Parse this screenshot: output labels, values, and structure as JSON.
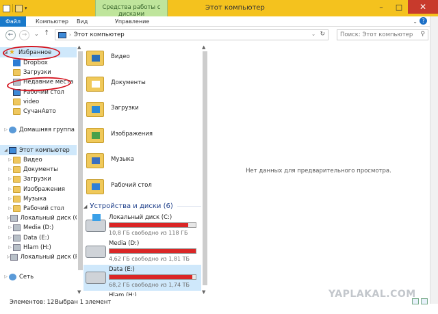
{
  "window": {
    "title": "Этот компьютер"
  },
  "ribbon": {
    "context_tab": "Средства работы с дисками",
    "tabs": [
      "Файл",
      "Компьютер",
      "Вид",
      "Управление"
    ]
  },
  "address": {
    "path": "Этот компьютер",
    "search_placeholder": "Поиск: Этот компьютер"
  },
  "nav": {
    "items": [
      {
        "label": "Избранное",
        "icon": "star-icon",
        "kind": "header",
        "selected": true
      },
      {
        "label": "Dropbox",
        "icon": "dropbox-icon"
      },
      {
        "label": "Загрузки",
        "icon": "folder-icon"
      },
      {
        "label": "Недавние места",
        "icon": "recent-places-icon"
      },
      {
        "label": "Рабочий стол",
        "icon": "desktop-icon"
      },
      {
        "label": "video",
        "icon": "folder-icon"
      },
      {
        "label": "СучанАвто",
        "icon": "folder-icon"
      },
      {
        "label": "Домашняя группа",
        "icon": "homegroup-icon",
        "kind": "header"
      },
      {
        "label": "Этот компьютер",
        "icon": "computer-icon",
        "kind": "header",
        "selected": true
      },
      {
        "label": "Видео",
        "icon": "folder-icon"
      },
      {
        "label": "Документы",
        "icon": "folder-icon"
      },
      {
        "label": "Загрузки",
        "icon": "folder-icon"
      },
      {
        "label": "Изображения",
        "icon": "folder-icon"
      },
      {
        "label": "Музыка",
        "icon": "folder-icon"
      },
      {
        "label": "Рабочий стол",
        "icon": "folder-icon"
      },
      {
        "label": "Локальный диск (C",
        "icon": "drive-icon"
      },
      {
        "label": "Media (D:)",
        "icon": "drive-icon"
      },
      {
        "label": "Data (E:)",
        "icon": "drive-icon"
      },
      {
        "label": "Hlam (H:)",
        "icon": "drive-icon"
      },
      {
        "label": "Локальный диск (R",
        "icon": "drive-icon"
      },
      {
        "label": "Сеть",
        "icon": "network-icon",
        "kind": "header"
      }
    ]
  },
  "folders": [
    {
      "label": "Видео",
      "icon": "video-folder-icon"
    },
    {
      "label": "Документы",
      "icon": "documents-folder-icon"
    },
    {
      "label": "Загрузки",
      "icon": "downloads-folder-icon"
    },
    {
      "label": "Изображения",
      "icon": "pictures-folder-icon"
    },
    {
      "label": "Музыка",
      "icon": "music-folder-icon"
    },
    {
      "label": "Рабочий стол",
      "icon": "desktop-folder-icon"
    }
  ],
  "devices": {
    "heading": "Устройства и диски (6)",
    "items": [
      {
        "label": "Локальный диск (C:)",
        "free": "10,8 ГБ свободно из 118 ГБ",
        "used_fraction": 0.91
      },
      {
        "label": "Media (D:)",
        "free": "4,62 ГБ свободно из 1,81 ТБ",
        "used_fraction": 0.997
      },
      {
        "label": "Data (E:)",
        "free": "68,2 ГБ свободно из 1,74 ТБ",
        "used_fraction": 0.96
      },
      {
        "label": "Hlam (H:)",
        "free": "",
        "used_fraction": null
      }
    ]
  },
  "preview": {
    "message": "Нет данных для предварительного просмотра."
  },
  "status": {
    "count": "Элементов: 12",
    "selected": "Выбран 1 элемент"
  },
  "watermark": "YAPLAKAL.COM",
  "colors": {
    "titlebar": "#f4c21e",
    "context_tab": "#bfe59c",
    "file_tab": "#1979ca",
    "drive_bar": "#da2626",
    "annotation": "#d4141f",
    "selection": "#cfe8fb"
  }
}
